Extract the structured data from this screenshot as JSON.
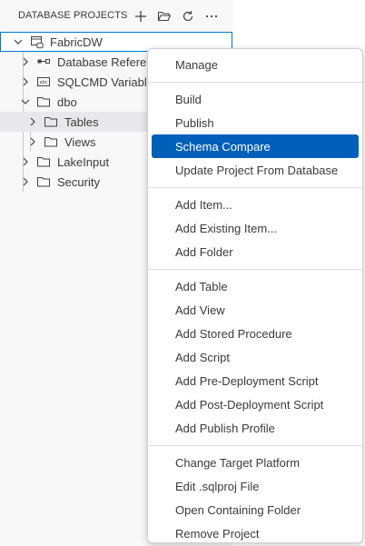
{
  "panel": {
    "title": "DATABASE PROJECTS",
    "actions": [
      {
        "icon": "add-icon",
        "name": "new-project-button"
      },
      {
        "icon": "folder-open-icon",
        "name": "open-project-button"
      },
      {
        "icon": "refresh-icon",
        "name": "refresh-button"
      },
      {
        "icon": "more-icon",
        "name": "more-actions-button"
      }
    ]
  },
  "tree": {
    "root": "FabricDW",
    "items": [
      {
        "label": "Database References",
        "icon": "database-reference-icon"
      },
      {
        "label": "SQLCMD Variables",
        "icon": "sqlcmd-variable-icon"
      },
      {
        "label": "dbo",
        "icon": "folder-icon"
      },
      {
        "label": "Tables",
        "icon": "folder-icon"
      },
      {
        "label": "Views",
        "icon": "folder-icon"
      },
      {
        "label": "LakeInput",
        "icon": "folder-icon"
      },
      {
        "label": "Security",
        "icon": "folder-icon"
      }
    ]
  },
  "menu": {
    "groups": [
      [
        "Manage"
      ],
      [
        "Build",
        "Publish",
        "Schema Compare",
        "Update Project From Database"
      ],
      [
        "Add Item...",
        "Add Existing Item...",
        "Add Folder"
      ],
      [
        "Add Table",
        "Add View",
        "Add Stored Procedure",
        "Add Script",
        "Add Pre-Deployment Script",
        "Add Post-Deployment Script",
        "Add Publish Profile"
      ],
      [
        "Change Target Platform",
        "Edit .sqlproj File",
        "Open Containing Folder",
        "Remove Project"
      ]
    ],
    "active": "Schema Compare"
  },
  "colors": {
    "accent": "#005fb8",
    "focus_border": "#0078d4",
    "sidebar_bg": "#f8f8f8",
    "hover_row": "#e8e8ec"
  }
}
